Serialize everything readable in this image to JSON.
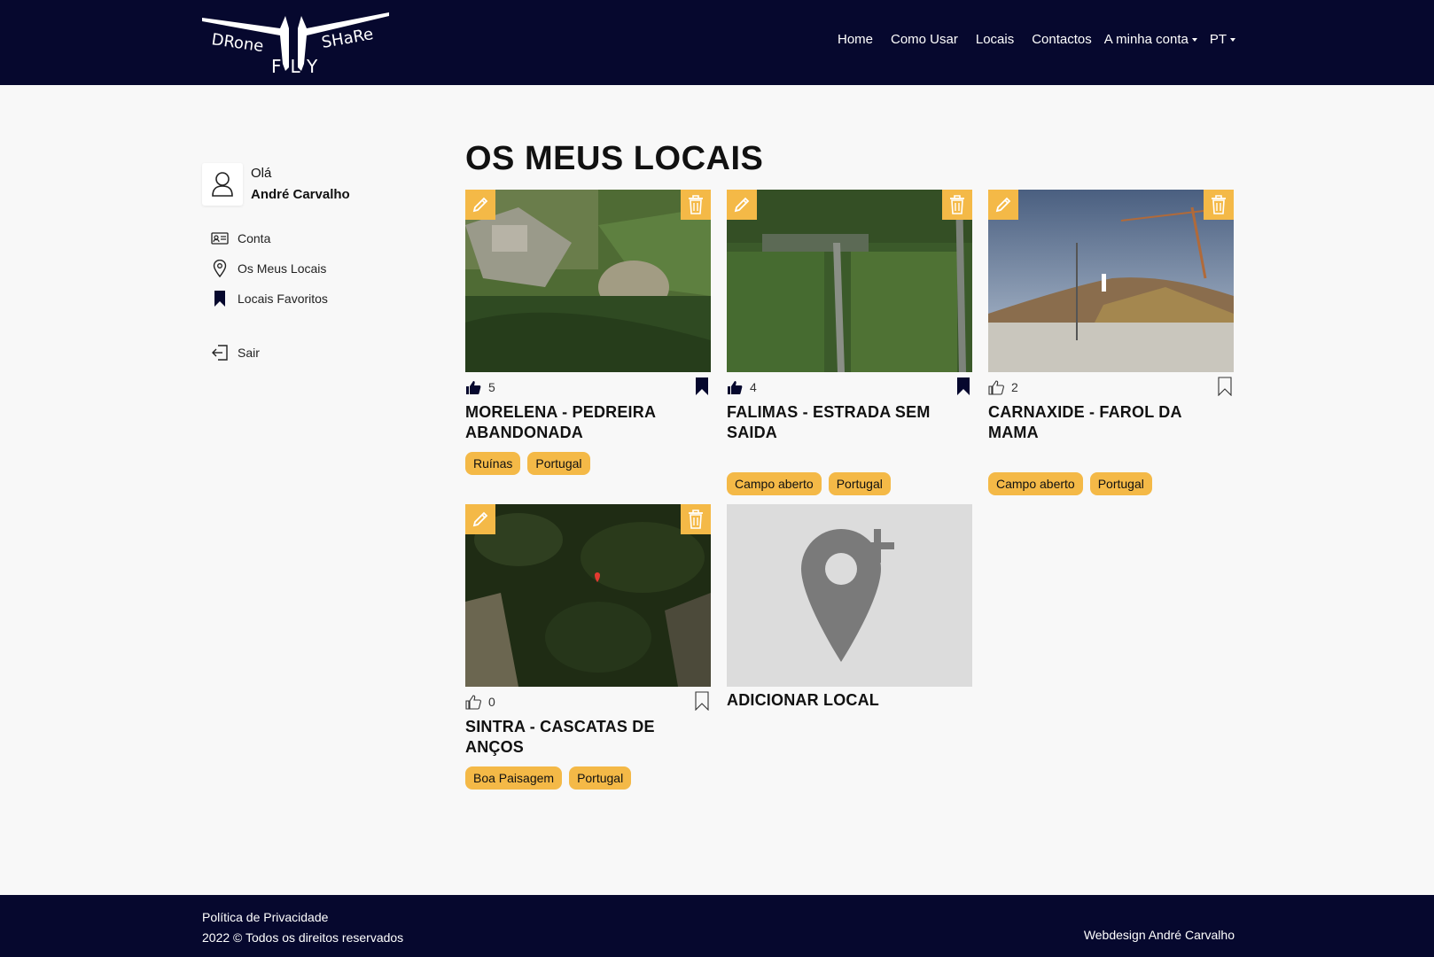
{
  "brand": {
    "logo_text_left": "DRone",
    "logo_text_right": "SHaRe",
    "logo_text_bottom": "FLY"
  },
  "nav": {
    "items": [
      "Home",
      "Como Usar",
      "Locais",
      "Contactos"
    ],
    "account": "A minha conta",
    "language": "PT"
  },
  "sidebar": {
    "greeting": "Olá",
    "user_name": "André Carvalho",
    "items": [
      "Conta",
      "Os Meus Locais",
      "Locais Favoritos"
    ],
    "logout": "Sair"
  },
  "main": {
    "title": "OS MEUS LOCAIS",
    "cards": [
      {
        "title": "MORELENA - PEDREIRA ABANDONADA",
        "likes": "5",
        "liked": true,
        "saved": true,
        "tags": [
          "Ruínas",
          "Portugal"
        ]
      },
      {
        "title": "FALIMAS - ESTRADA SEM SAIDA",
        "likes": "4",
        "liked": true,
        "saved": true,
        "tags": [
          "Campo aberto",
          "Portugal"
        ]
      },
      {
        "title": "CARNAXIDE - FAROL DA MAMA",
        "likes": "2",
        "liked": false,
        "saved": false,
        "tags": [
          "Campo aberto",
          "Portugal"
        ]
      },
      {
        "title": "SINTRA - CASCATAS DE ANÇOS",
        "likes": "0",
        "liked": false,
        "saved": false,
        "tags": [
          "Boa Paisagem",
          "Portugal"
        ]
      }
    ],
    "add_label": "ADICIONAR LOCAL"
  },
  "footer": {
    "privacy": "Política de Privacidade",
    "copyright": "2022 © Todos os direitos reservados",
    "credit": "Webdesign André Carvalho"
  },
  "colors": {
    "navy": "#06082e",
    "accent": "#f4b947"
  }
}
